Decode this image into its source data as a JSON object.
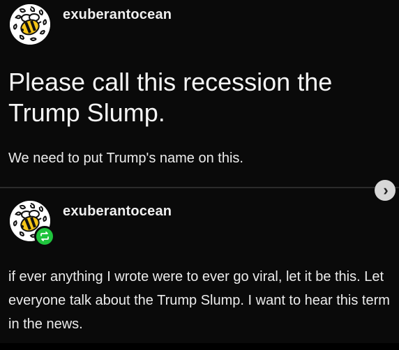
{
  "post": {
    "username": "exuberantocean",
    "title": "Please call this recession the Trump Slump.",
    "subtitle": "We need to put Trump's name on this.",
    "avatar_icon": "bee-icon"
  },
  "reblog": {
    "username": "exuberantocean",
    "body": "if ever anything I wrote were to ever go viral, let it be this.  Let everyone talk about the Trump Slump.  I want to hear this term in the news.",
    "avatar_icon": "bee-icon",
    "badge_icon": "reblog-icon",
    "badge_color": "#1fc43d"
  },
  "controls": {
    "next_icon": "chevron-right-icon",
    "next_glyph": "›"
  },
  "colors": {
    "background": "#0a0a0a",
    "text": "#f2f2f2",
    "divider": "#2b2b2b"
  }
}
